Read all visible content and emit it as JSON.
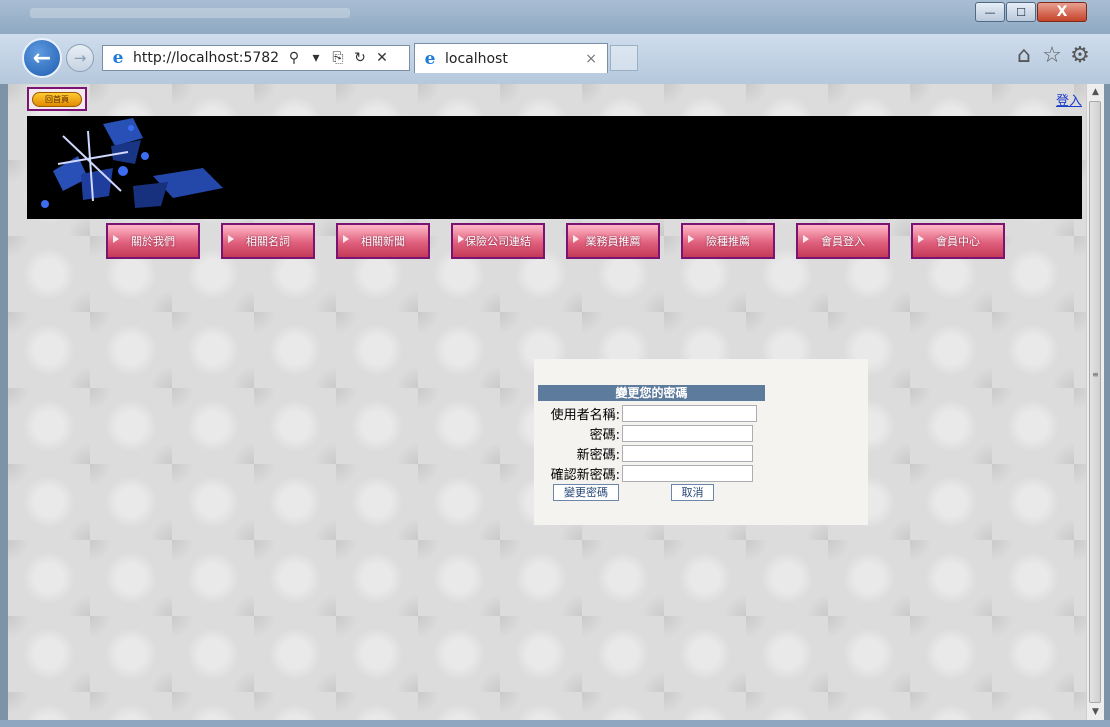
{
  "browser": {
    "address": "http://localhost:5782",
    "tab_title": "localhost",
    "close_glyph": "×",
    "min_glyph": "—",
    "max_glyph": "☐",
    "close_window_glyph": "X",
    "back_glyph": "←",
    "forward_glyph": "→",
    "ie_glyph": "e",
    "search_glyph": "⚲",
    "dropdown_glyph": "▾",
    "compat_glyph": "⎘",
    "refresh_glyph": "↻",
    "stop_glyph": "✕",
    "home_glyph": "⌂",
    "favorites_glyph": "☆",
    "settings_glyph": "⚙",
    "scroll_up_glyph": "▲",
    "scroll_down_glyph": "▼",
    "scroll_grip_glyph": "≡"
  },
  "page": {
    "home_button": "回首頁",
    "login_link": "登入",
    "menu": [
      "關於我們",
      "相關名詞",
      "相關新聞",
      "保險公司連結",
      "業務員推薦",
      "險種推薦",
      "會員登入",
      "會員中心"
    ]
  },
  "change_password": {
    "title": "變更您的密碼",
    "username_label": "使用者名稱:",
    "password_label": "密碼:",
    "new_password_label": "新密碼:",
    "confirm_password_label": "確認新密碼:",
    "username_value": "",
    "password_value": "",
    "new_password_value": "",
    "confirm_password_value": "",
    "submit_label": "變更密碼",
    "cancel_label": "取消"
  },
  "colors": {
    "banner": "#000000",
    "menu_border": "#7a1372",
    "form_header": "#5d7b9d",
    "link": "#1a3ccc"
  }
}
